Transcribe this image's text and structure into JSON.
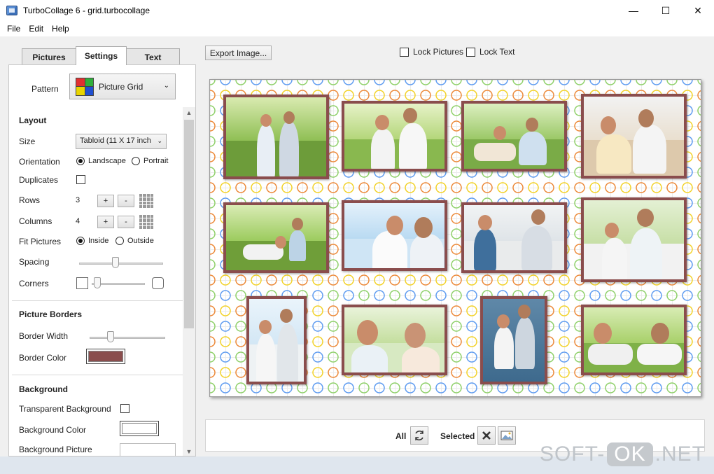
{
  "window": {
    "title": "TurboCollage 6 - grid.turbocollage",
    "minimize": "—",
    "maximize": "☐",
    "close": "✕"
  },
  "menu": [
    "File",
    "Edit",
    "Help"
  ],
  "tabs": [
    "Pictures",
    "Settings",
    "Text"
  ],
  "active_tab": "Settings",
  "pattern": {
    "label": "Pattern",
    "value": "Picture Grid",
    "colors": [
      "#e03030",
      "#2fae3a",
      "#e8d400",
      "#1f4fd1"
    ]
  },
  "layout": {
    "title": "Layout",
    "size_label": "Size",
    "size_value": "Tabloid (11 X 17 inch",
    "orientation_label": "Orientation",
    "landscape": "Landscape",
    "portrait": "Portrait",
    "orientation_selected": "Landscape",
    "duplicates_label": "Duplicates",
    "duplicates_checked": false,
    "rows_label": "Rows",
    "rows_value": "3",
    "columns_label": "Columns",
    "columns_value": "4",
    "plus": "+",
    "minus": "-",
    "fit_label": "Fit Pictures",
    "inside": "Inside",
    "outside": "Outside",
    "fit_selected": "Inside",
    "spacing_label": "Spacing",
    "spacing_value": 0.43,
    "corners_label": "Corners",
    "corners_value": 0.05
  },
  "borders": {
    "title": "Picture Borders",
    "width_label": "Border Width",
    "width_value": 0.25,
    "color_label": "Border Color",
    "color": "#8a4d4d"
  },
  "background": {
    "title": "Background",
    "transparent_label": "Transparent Background",
    "transparent_checked": false,
    "color_label": "Background Color",
    "color": "#ffffff",
    "picture_label": "Background Picture"
  },
  "toolbar": {
    "export": "Export Image...",
    "lock_pictures": "Lock Pictures",
    "lock_text": "Lock Text"
  },
  "bottom": {
    "all": "All",
    "selected": "Selected"
  },
  "watermark": {
    "left": "SOFT-",
    "mid": "OK",
    "right": ".NET"
  }
}
